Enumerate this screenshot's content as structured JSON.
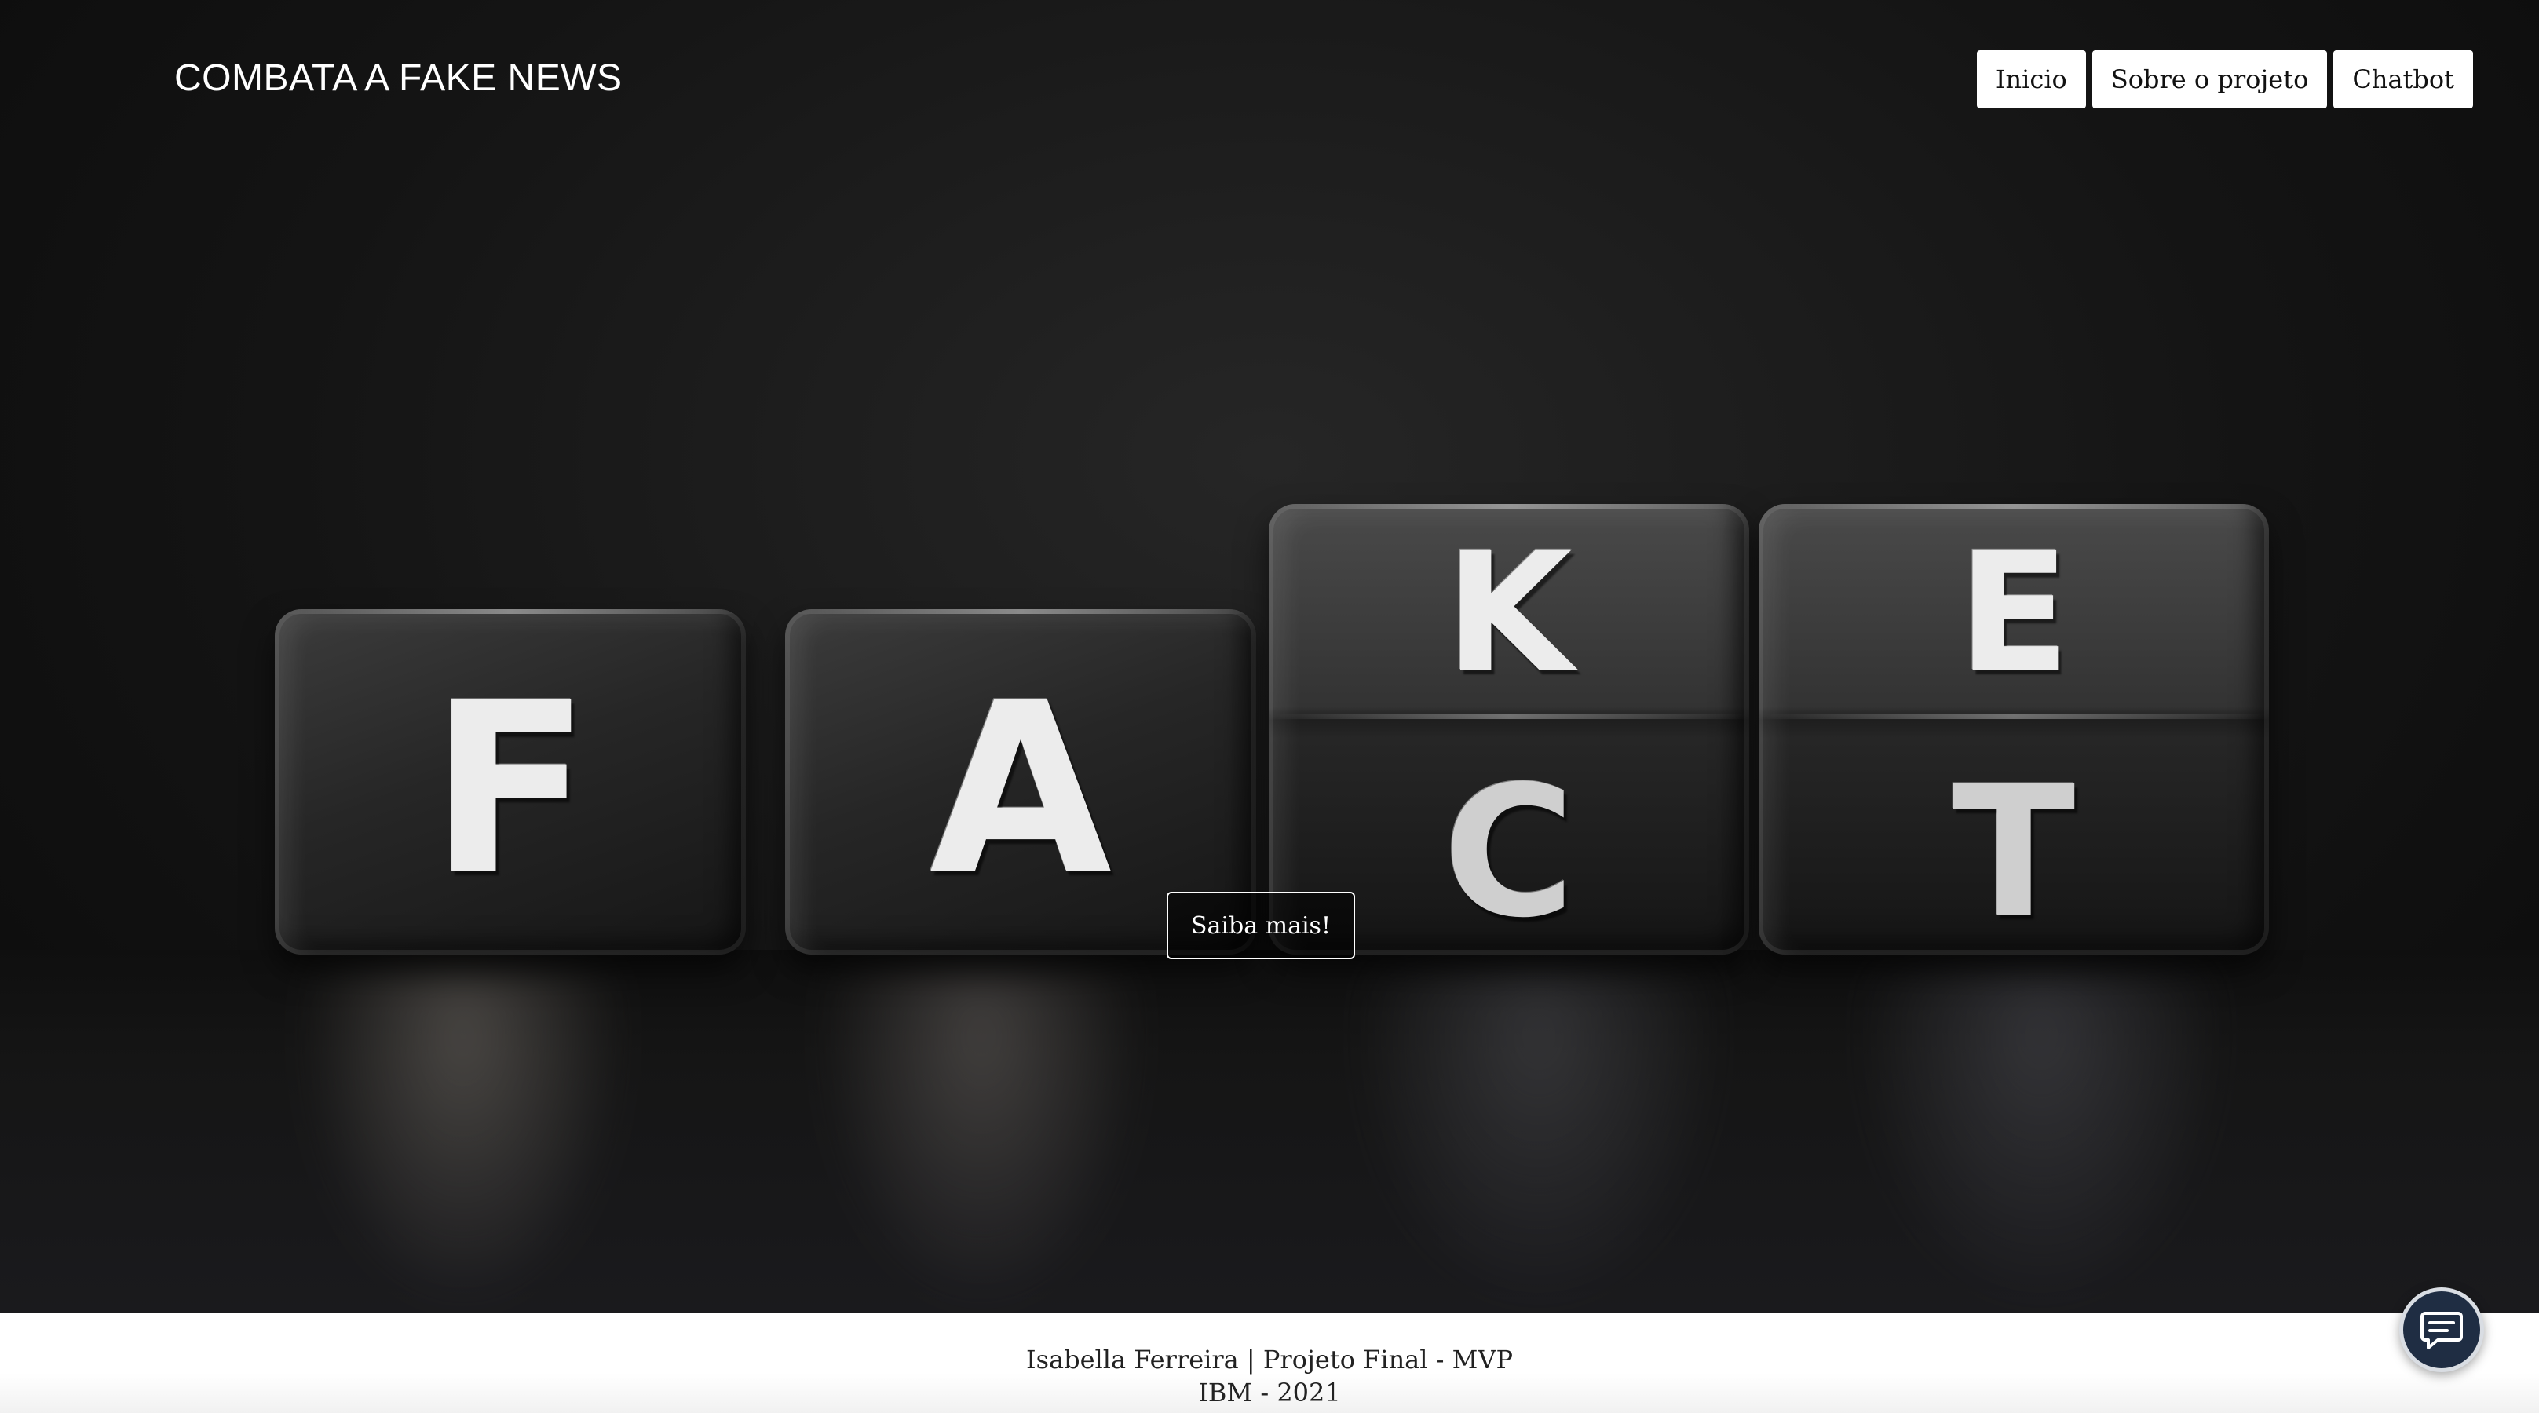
{
  "header": {
    "brand": "COMBATA A FAKE NEWS",
    "nav": [
      {
        "label": "Inicio"
      },
      {
        "label": "Sobre o projeto"
      },
      {
        "label": "Chatbot"
      }
    ]
  },
  "hero": {
    "dice": [
      {
        "top_letter": "",
        "front_letter": "F"
      },
      {
        "top_letter": "",
        "front_letter": "A"
      },
      {
        "top_letter": "K",
        "front_letter": "C"
      },
      {
        "top_letter": "E",
        "front_letter": "T"
      }
    ],
    "cta_label": "Saiba mais!"
  },
  "footer": {
    "line1": "Isabella Ferreira | Projeto Final - MVP",
    "line2": "IBM - 2021"
  },
  "chat_launcher": {
    "icon": "chat-bubble-icon"
  },
  "colors": {
    "hero_background": "#141414",
    "die_face": "#262626",
    "letter": "#ececec",
    "chat_launcher": "#1f2d43",
    "footer_background": "#ffffff"
  }
}
